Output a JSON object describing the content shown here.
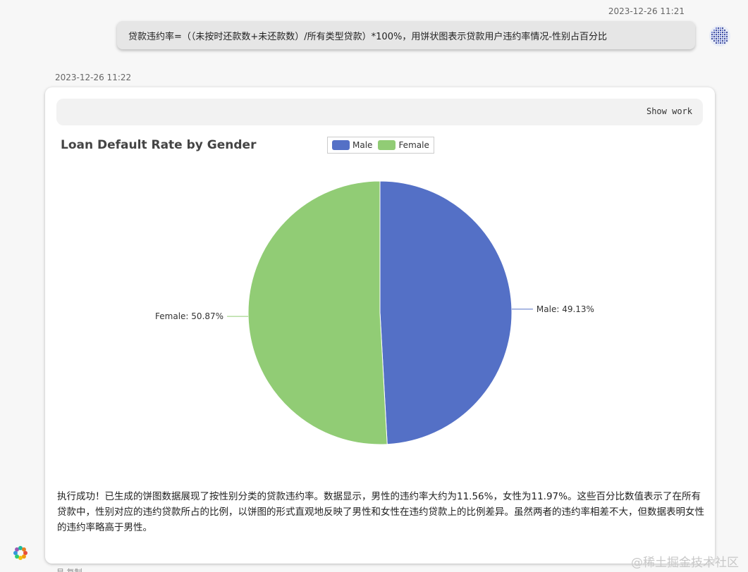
{
  "user_message": {
    "timestamp": "2023-12-26 11:21",
    "text": "贷款违约率=（（未按时还款数+未还款数）/所有类型贷款）*100%，用饼状图表示贷款用户违约率情况-性别占百分比"
  },
  "assistant_message": {
    "timestamp": "2023-12-26 11:22",
    "show_work_label": "Show work",
    "summary": "执行成功！已生成的饼图数据展现了按性别分类的贷款违约率。数据显示，男性的违约率大约为11.56%，女性为11.97%。这些百分比数值表示了在所有贷款中，性别对应的违约贷款所占的比例，以饼图的形式直观地反映了男性和女性在违约贷款上的比例差异。虽然两者的违约率相差不大，但数据表明女性的违约率略高于男性。"
  },
  "footer_partial": "显 复制",
  "watermark": "@稀土掘金技术社区",
  "chart_data": {
    "type": "pie",
    "title": "Loan Default Rate by Gender",
    "legend_position": "top-center",
    "categories": [
      "Male",
      "Female"
    ],
    "values": [
      49.13,
      50.87
    ],
    "labels": [
      "Male: 49.13%",
      "Female: 50.87%"
    ],
    "colors": [
      "#5470c6",
      "#91cc75"
    ]
  }
}
